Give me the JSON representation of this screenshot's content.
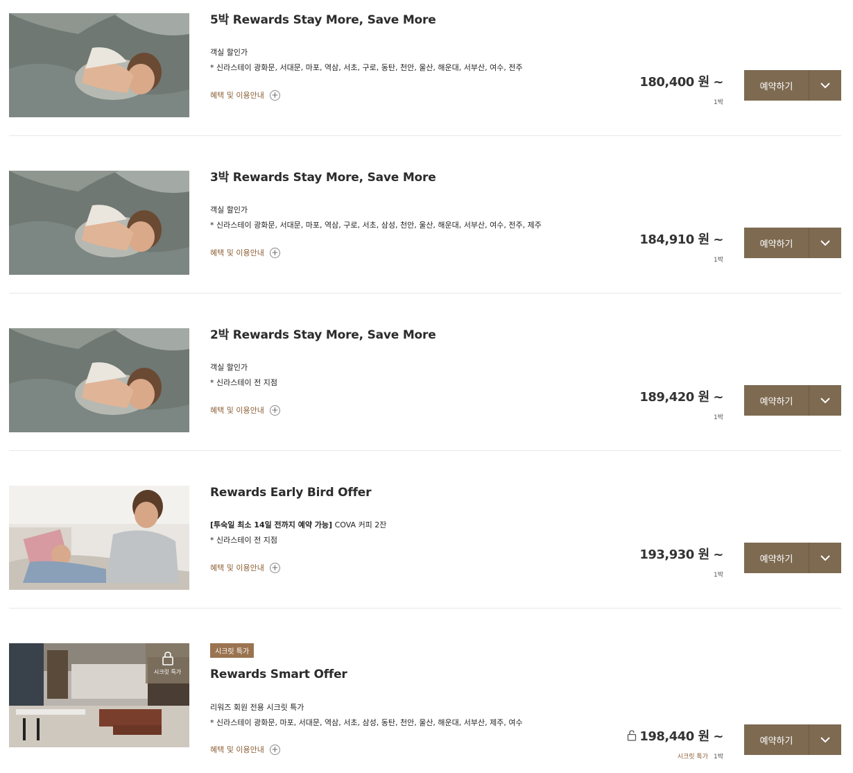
{
  "offers": [
    {
      "title": "5박 Rewards Stay More, Save More",
      "line1": "객실 할인가",
      "line2": "* 신라스테이 광화문, 서대문, 마포, 역삼, 서초, 구로, 동탄, 천안, 울산, 해운대, 서부산, 여수, 전주",
      "benefit": "혜택 및 이용안내",
      "price": "180,400 원 ~",
      "nights": "1박",
      "book": "예약하기",
      "image": "sleeping-woman"
    },
    {
      "title": "3박 Rewards Stay More, Save More",
      "line1": "객실 할인가",
      "line2": "* 신라스테이 광화문, 서대문, 마포, 역삼, 구로, 서초, 삼성, 천안, 울산, 해운대, 서부산, 여수, 전주, 제주",
      "benefit": "혜택 및 이용안내",
      "price": "184,910 원 ~",
      "nights": "1박",
      "book": "예약하기",
      "image": "sleeping-woman"
    },
    {
      "title": "2박 Rewards Stay More, Save More",
      "line1": "객실 할인가",
      "line2": "* 신라스테이 전 지점",
      "benefit": "혜택 및 이용안내",
      "price": "189,420 원 ~",
      "nights": "1박",
      "book": "예약하기",
      "image": "sleeping-woman"
    },
    {
      "title": "Rewards Early Bird Offer",
      "line1_bold": "[투숙일 최소 14일 전까지 예약 가능]",
      "line1_rest": " COVA 커피 2잔",
      "line2": "* 신라스테이 전 지점",
      "benefit": "혜택 및 이용안내",
      "price": "193,930 원 ~",
      "nights": "1박",
      "book": "예약하기",
      "image": "father-child"
    },
    {
      "badge": "시크릿 특가",
      "overlay_label": "시크릿 특가",
      "title": "Rewards Smart Offer",
      "line1": "리워즈 회원 전용 시크릿 특가",
      "line2": "* 신라스테이 광화문, 마포, 서대문, 역삼, 서초, 삼성, 동탄, 천안, 울산, 해운대, 서부산, 제주, 여수",
      "benefit": "혜택 및 이용안내",
      "price": "198,440 원 ~",
      "secret_label": "시크릿 특가",
      "nights": "1박",
      "book": "예약하기",
      "image": "hotel-lounge"
    }
  ],
  "colors": {
    "button": "#7d6a51",
    "benefit_text": "#8b5e34",
    "badge": "#9a7450",
    "divider": "#e8e8e8"
  }
}
